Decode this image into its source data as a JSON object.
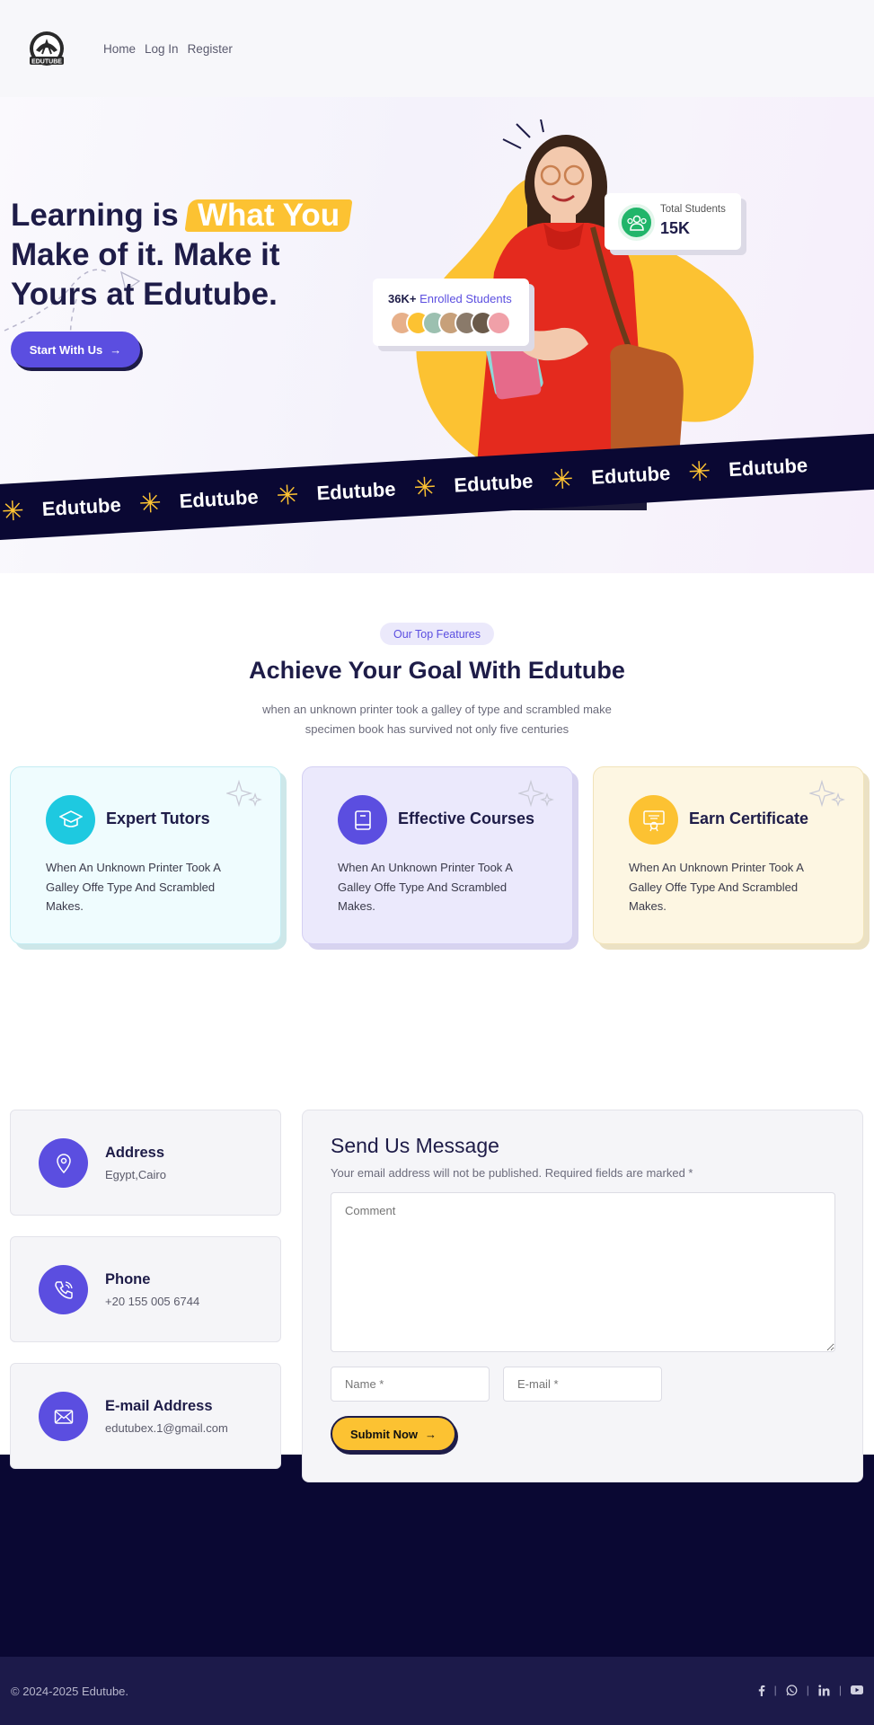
{
  "nav": {
    "logo_text": "EDUTUBE",
    "links": [
      "Home",
      "Log In",
      "Register"
    ]
  },
  "hero": {
    "title_part1": "Learning is",
    "title_highlight": "What You",
    "title_line2": "Make of it. Make it",
    "title_line3": "Yours at Edutube.",
    "cta_label": "Start With Us",
    "enrolled_count": "36K+",
    "enrolled_label": "Enrolled Students",
    "total_students_label": "Total Students",
    "total_students_value": "15K"
  },
  "marquee": {
    "word": "Edutube",
    "star": "✳"
  },
  "features": {
    "badge": "Our Top Features",
    "title": "Achieve Your Goal With Edutube",
    "subtitle": "when an unknown printer took a galley of type and scrambled make specimen book has survived not only five centuries",
    "cards": [
      {
        "name": "Expert Tutors",
        "desc": "When An Unknown Printer Took A Galley Offe Type And Scrambled Makes.",
        "icon": "graduation-cap-icon",
        "color": "#1ec9e0"
      },
      {
        "name": "Effective Courses",
        "desc": "When An Unknown Printer Took A Galley Offe Type And Scrambled Makes.",
        "icon": "book-icon",
        "color": "#5b4ee0"
      },
      {
        "name": "Earn Certificate",
        "desc": "When An Unknown Printer Took A Galley Offe Type And Scrambled Makes.",
        "icon": "certificate-icon",
        "color": "#fcc232"
      }
    ]
  },
  "contact": {
    "cards": [
      {
        "title": "Address",
        "value": "Egypt,Cairo",
        "icon": "location-pin-icon"
      },
      {
        "title": "Phone",
        "value": "+20 155 005 6744",
        "icon": "phone-icon"
      },
      {
        "title": "E-mail Address",
        "value": "edutubex.1@gmail.com",
        "icon": "mail-icon"
      }
    ],
    "form": {
      "title": "Send Us Message",
      "subtitle": "Your email address will not be published. Required fields are marked *",
      "comment_placeholder": "Comment",
      "name_placeholder": "Name *",
      "email_placeholder": "E-mail *",
      "submit_label": "Submit Now"
    }
  },
  "footer": {
    "copyright": "© 2024-2025 Edutube.",
    "social_icons": [
      "facebook-icon",
      "whatsapp-icon",
      "linkedin-icon",
      "youtube-icon"
    ]
  },
  "colors": {
    "accent_purple": "#5b4ee0",
    "accent_yellow": "#fcc232",
    "navy": "#0a0833",
    "footer_bg": "#1c1a4a"
  }
}
